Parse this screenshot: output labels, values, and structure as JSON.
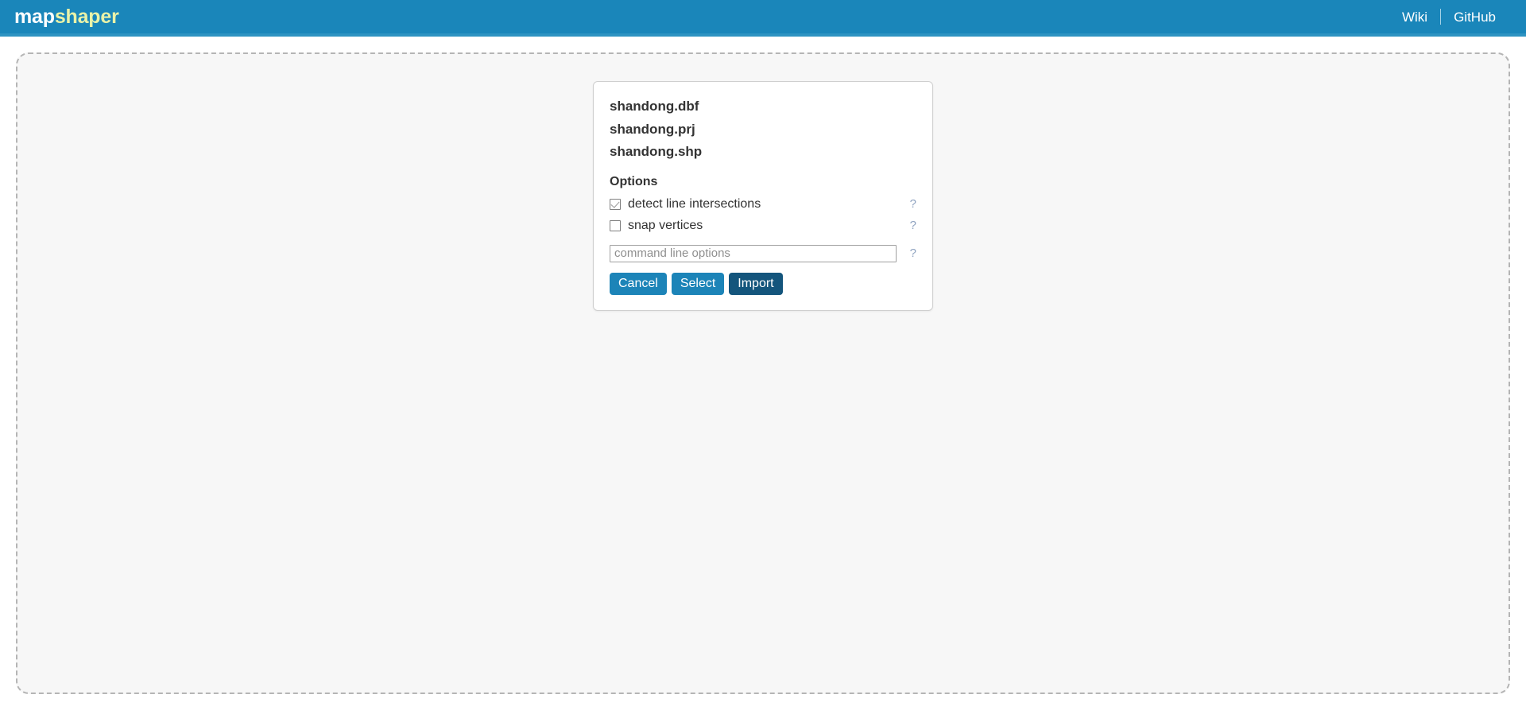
{
  "header": {
    "logo_primary": "map",
    "logo_secondary": "shaper",
    "links": [
      {
        "label": "Wiki"
      },
      {
        "label": "GitHub"
      }
    ],
    "background_color": "#1a86ba",
    "logo_primary_color": "#ffffff",
    "logo_secondary_color": "#e9f2a8"
  },
  "dropzone": {
    "background_color": "#f7f7f7",
    "border_color": "#b5b5b5"
  },
  "dialog": {
    "files": [
      {
        "name": "shandong.dbf"
      },
      {
        "name": "shandong.prj"
      },
      {
        "name": "shandong.shp"
      }
    ],
    "options_title": "Options",
    "options": [
      {
        "label": "detect line intersections",
        "checked": true,
        "help": "?"
      },
      {
        "label": "snap vertices",
        "checked": false,
        "help": "?"
      }
    ],
    "cli": {
      "value": "",
      "placeholder": "command line options",
      "help": "?"
    },
    "buttons": [
      {
        "label": "Cancel",
        "style": "primary-light",
        "color": "#1c84b8"
      },
      {
        "label": "Select",
        "style": "primary-light",
        "color": "#1c84b8"
      },
      {
        "label": "Import",
        "style": "primary-dark",
        "color": "#14557c"
      }
    ]
  }
}
